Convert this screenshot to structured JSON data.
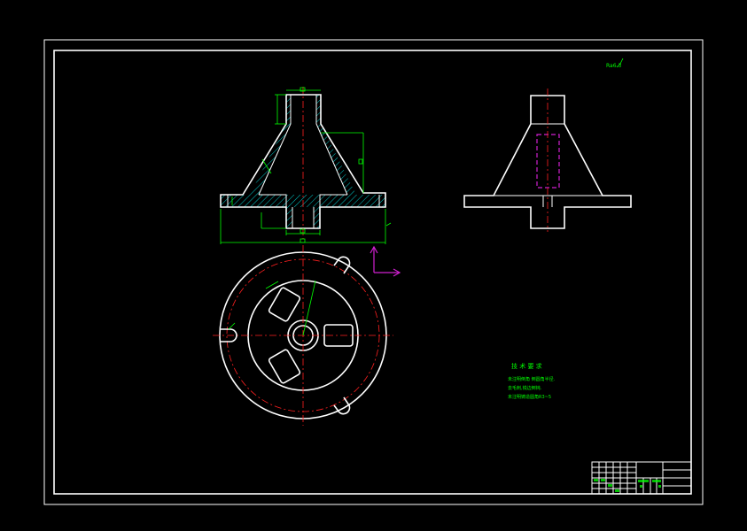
{
  "colors": {
    "background": "#000000",
    "outline": "#ffffff",
    "dimension": "#00ff00",
    "centerline": "#ff2020",
    "hatch": "#00e0e0",
    "hidden": "#d020d0"
  },
  "roughness_note": "Ra6.3",
  "notes": {
    "heading": "技 术 要 求",
    "lines": [
      "未注明倒角 倒圆角半径.",
      "去毛刺,锐边倒钝.",
      "未注明铸造圆角R3~5"
    ]
  },
  "title_block": {
    "cells": []
  }
}
